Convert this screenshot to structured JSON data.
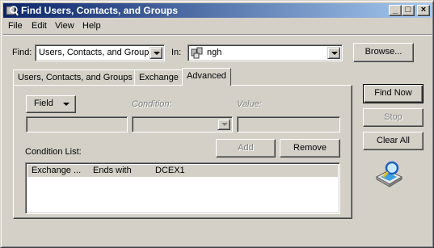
{
  "window": {
    "title": "Find Users, Contacts, and Groups",
    "controls": {
      "minimize": "_",
      "maximize": "□",
      "close": "×"
    }
  },
  "menu": {
    "items": [
      {
        "label": "File",
        "accel": "F"
      },
      {
        "label": "Edit",
        "accel": "E"
      },
      {
        "label": "View",
        "accel": "V"
      },
      {
        "label": "Help",
        "accel": "H"
      }
    ]
  },
  "search": {
    "find_label": "Find:",
    "find_value": "Users, Contacts, and Groups",
    "in_label": "In:",
    "in_value": "ngh",
    "browse_label": "Browse..."
  },
  "tabs": [
    {
      "label": "Users, Contacts, and Groups",
      "active": false
    },
    {
      "label": "Exchange",
      "active": false
    },
    {
      "label": "Advanced",
      "active": true
    }
  ],
  "advanced": {
    "field_button": "Field",
    "condition_label": "Condition:",
    "value_label": "Value:",
    "add_label": "Add",
    "remove_label": "Remove",
    "condition_list_label": "Condition List:",
    "conditions": [
      {
        "field": "Exchange ...",
        "condition": "Ends with",
        "value": "DCEX1"
      }
    ]
  },
  "actions": {
    "find_now": "Find Now",
    "stop": "Stop",
    "clear_all": "Clear All"
  },
  "colors": {
    "title_start": "#0a246a",
    "title_end": "#a6caf0",
    "face": "#d4d0c8"
  }
}
